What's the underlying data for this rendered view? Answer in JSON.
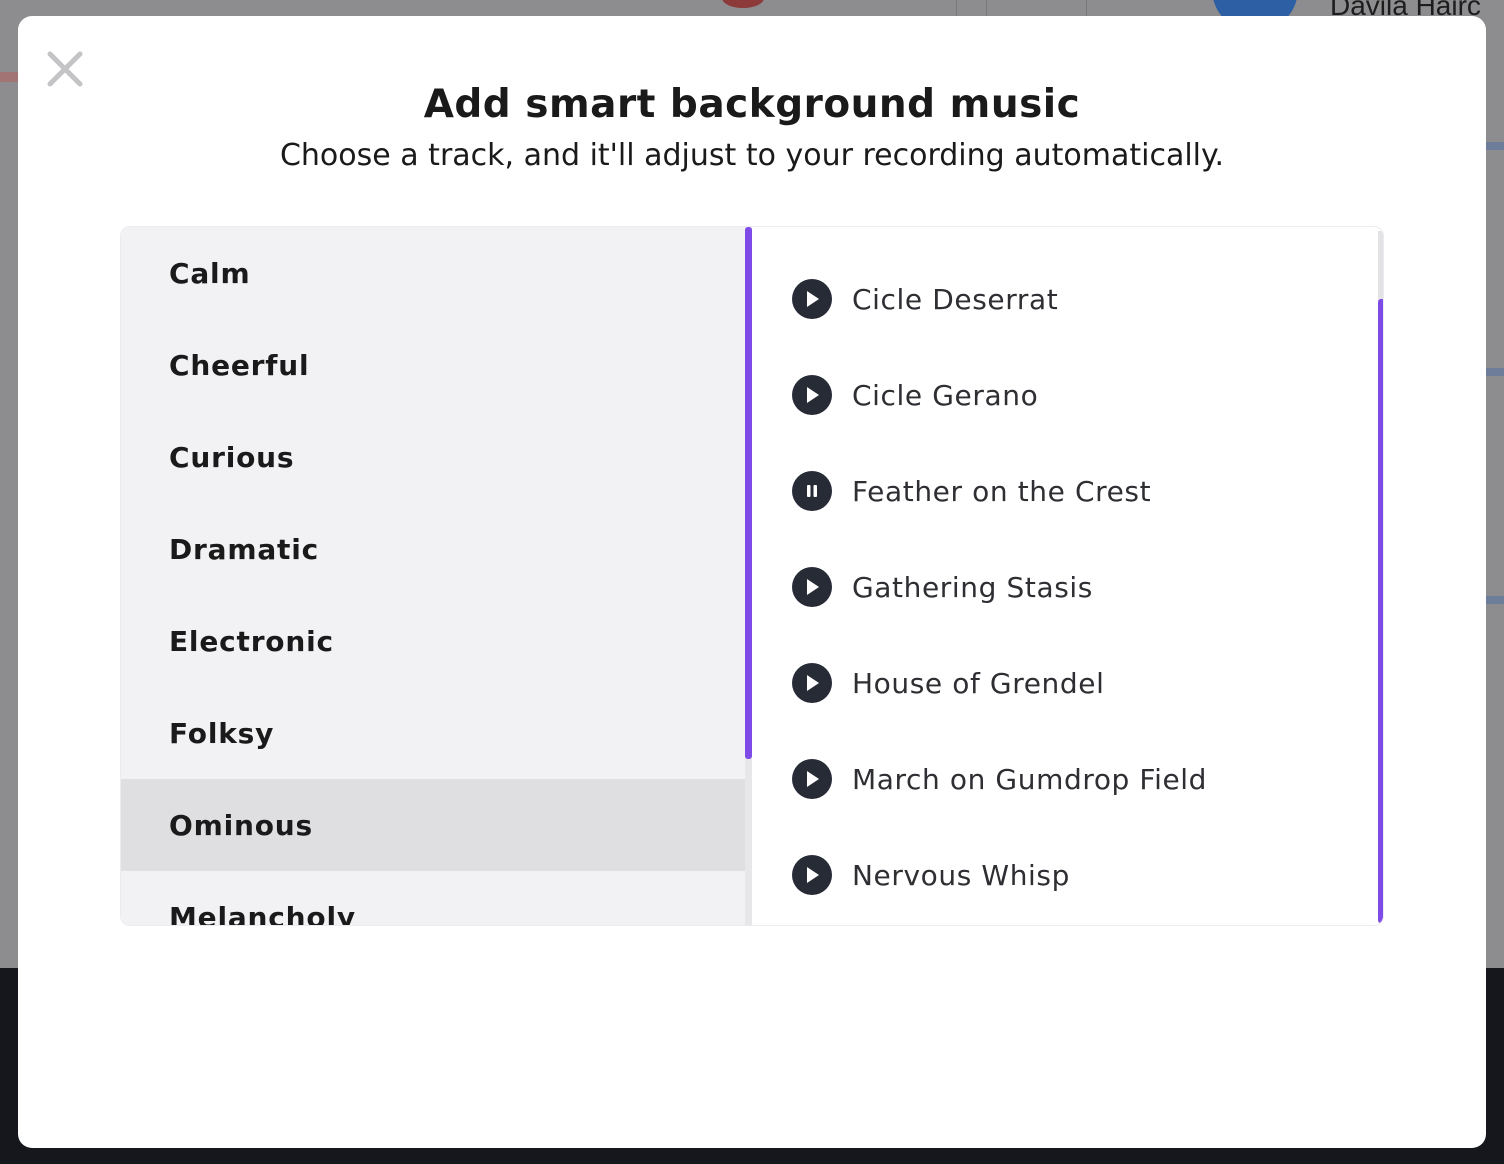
{
  "background": {
    "partial_text": "Davila Hairc"
  },
  "modal": {
    "title": "Add smart background music",
    "subtitle": "Choose a track, and it'll adjust to your recording automatically.",
    "close_icon": "close-icon"
  },
  "categories": {
    "selected": "Ominous",
    "items": [
      {
        "label": "Calm"
      },
      {
        "label": "Cheerful"
      },
      {
        "label": "Curious"
      },
      {
        "label": "Dramatic"
      },
      {
        "label": "Electronic"
      },
      {
        "label": "Folksy"
      },
      {
        "label": "Ominous"
      },
      {
        "label": "Melancholy"
      }
    ]
  },
  "tracks": {
    "items": [
      {
        "label": "Cicle Deserrat",
        "state": "play",
        "icon": "play-icon"
      },
      {
        "label": "Cicle Gerano",
        "state": "play",
        "icon": "play-icon"
      },
      {
        "label": "Feather on the Crest",
        "state": "pause",
        "icon": "pause-icon"
      },
      {
        "label": "Gathering Stasis",
        "state": "play",
        "icon": "play-icon"
      },
      {
        "label": "House of Grendel",
        "state": "play",
        "icon": "play-icon"
      },
      {
        "label": "March on Gumdrop Field",
        "state": "play",
        "icon": "play-icon"
      },
      {
        "label": "Nervous Whisp",
        "state": "play",
        "icon": "play-icon"
      }
    ]
  },
  "colors": {
    "accent": "#7f4be8",
    "icon_bg": "#272b35",
    "selected_bg": "#dfdfe1",
    "list_bg": "#f2f2f5"
  }
}
